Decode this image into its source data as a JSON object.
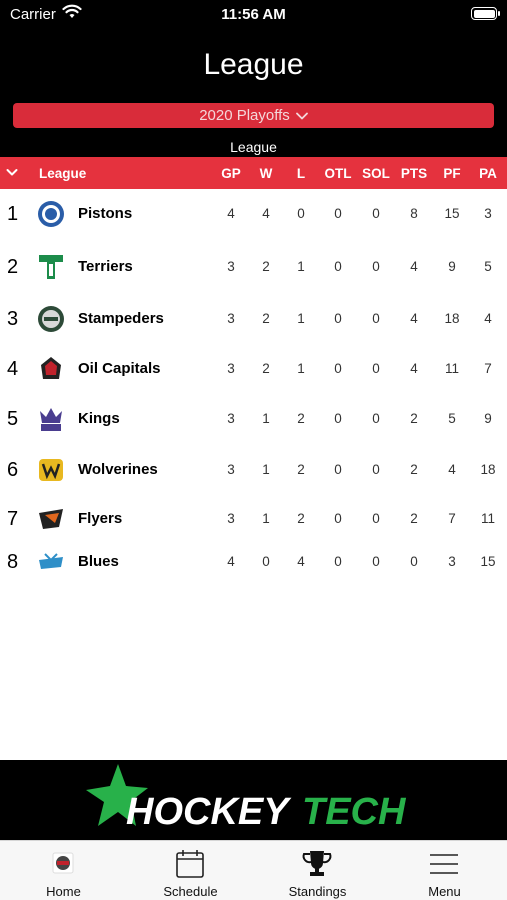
{
  "status_bar": {
    "carrier": "Carrier",
    "time": "11:56 AM"
  },
  "nav": {
    "title": "League"
  },
  "season_select": {
    "label": "2020 Playoffs"
  },
  "section_caption": "League",
  "table": {
    "headers": {
      "league": "League",
      "gp": "GP",
      "w": "W",
      "l": "L",
      "otl": "OTL",
      "sol": "SOL",
      "pts": "PTS",
      "pf": "PF",
      "pa": "PA"
    },
    "rows": [
      {
        "rank": "1",
        "team": "Pistons",
        "gp": "4",
        "w": "4",
        "l": "0",
        "otl": "0",
        "sol": "0",
        "pts": "8",
        "pf": "15",
        "pa": "3",
        "logo_color": "#2a5da8"
      },
      {
        "rank": "2",
        "team": "Terriers",
        "gp": "3",
        "w": "2",
        "l": "1",
        "otl": "0",
        "sol": "0",
        "pts": "4",
        "pf": "9",
        "pa": "5",
        "logo_color": "#1c8c4a"
      },
      {
        "rank": "3",
        "team": "Stampeders",
        "gp": "3",
        "w": "2",
        "l": "1",
        "otl": "0",
        "sol": "0",
        "pts": "4",
        "pf": "18",
        "pa": "4",
        "logo_color": "#2d4a38"
      },
      {
        "rank": "4",
        "team": "Oil Capitals",
        "gp": "3",
        "w": "2",
        "l": "1",
        "otl": "0",
        "sol": "0",
        "pts": "4",
        "pf": "11",
        "pa": "7",
        "logo_color": "#c0222c"
      },
      {
        "rank": "5",
        "team": "Kings",
        "gp": "3",
        "w": "1",
        "l": "2",
        "otl": "0",
        "sol": "0",
        "pts": "2",
        "pf": "5",
        "pa": "9",
        "logo_color": "#4a3d8f"
      },
      {
        "rank": "6",
        "team": "Wolverines",
        "gp": "3",
        "w": "1",
        "l": "2",
        "otl": "0",
        "sol": "0",
        "pts": "2",
        "pf": "4",
        "pa": "18",
        "logo_color": "#e8b820"
      },
      {
        "rank": "7",
        "team": "Flyers",
        "gp": "3",
        "w": "1",
        "l": "2",
        "otl": "0",
        "sol": "0",
        "pts": "2",
        "pf": "7",
        "pa": "11",
        "logo_color": "#e0671e"
      },
      {
        "rank": "8",
        "team": "Blues",
        "gp": "4",
        "w": "0",
        "l": "4",
        "otl": "0",
        "sol": "0",
        "pts": "0",
        "pf": "3",
        "pa": "15",
        "logo_color": "#2e8fc8"
      }
    ]
  },
  "ad_banner": {
    "brand_left": "HOCKEY",
    "brand_right": "TECH",
    "accent": "#28b14a"
  },
  "tabs": [
    {
      "label": "Home",
      "icon": "home-logo-icon"
    },
    {
      "label": "Schedule",
      "icon": "calendar-icon"
    },
    {
      "label": "Standings",
      "icon": "trophy-icon"
    },
    {
      "label": "Menu",
      "icon": "hamburger-menu-icon"
    }
  ],
  "colors": {
    "header_red": "#e5323e",
    "select_red": "#d92c3a",
    "background": "#000000"
  }
}
